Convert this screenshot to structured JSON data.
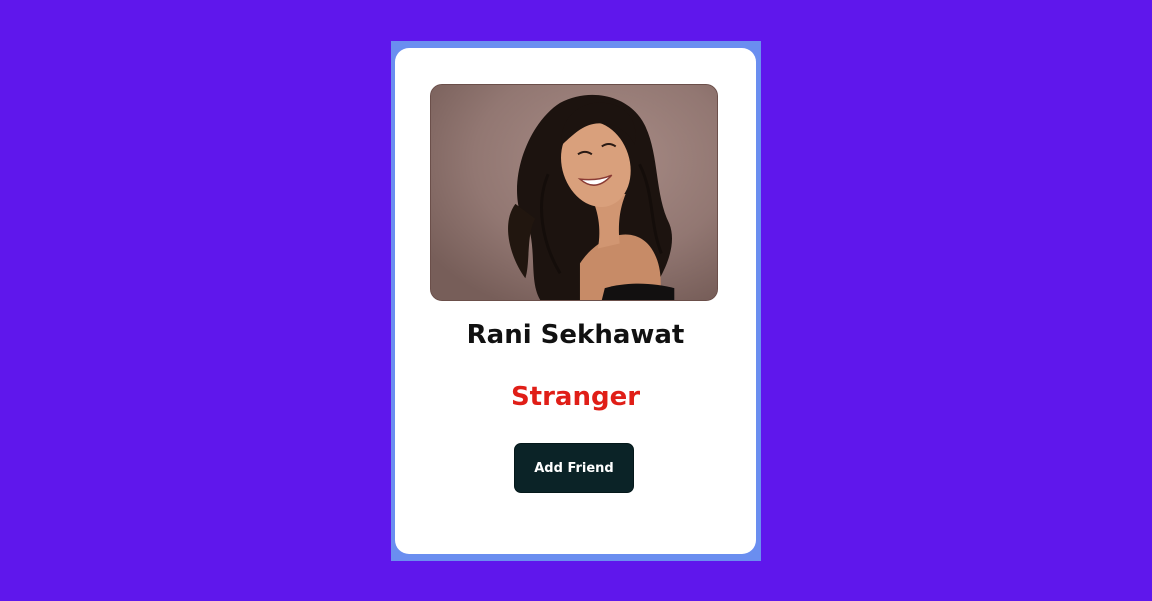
{
  "profile": {
    "name": "Rani Sekhawat",
    "status": "Stranger",
    "action_label": "Add Friend"
  },
  "colors": {
    "background": "#5f17ec",
    "card_frame": "#6a8ef0",
    "card": "#ffffff",
    "status": "#e01e17",
    "button": "#0b2327",
    "button_text": "#ffffff"
  }
}
